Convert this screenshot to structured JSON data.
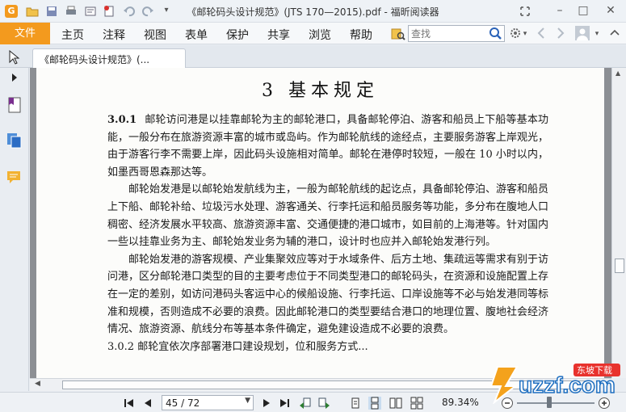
{
  "window": {
    "title": "《邮轮码头设计规范》(JTS 170—2015).pdf - 福昕阅读器",
    "app_logo_letter": "G"
  },
  "menu": {
    "file": "文件",
    "items": [
      "主页",
      "注释",
      "视图",
      "表单",
      "保护",
      "共享",
      "浏览",
      "帮助"
    ],
    "search_placeholder": "查找"
  },
  "tab": {
    "label": "《邮轮码头设计规范》(..."
  },
  "document": {
    "chapter": "3 基本规定",
    "section_number": "3.0.1",
    "para1": "邮轮访问港是以挂靠邮轮为主的邮轮港口，具备邮轮停泊、游客和船员上下船等基本功能，一般分布在旅游资源丰富的城市或岛屿。作为邮轮航线的途经点，主要服务游客上岸观光，由于游客行李不需要上岸，因此码头设施相对简单。邮轮在港停时较短，一般在 10 小时以内，如墨西哥恩森那达等。",
    "para2": "邮轮始发港是以邮轮始发航线为主，一般为邮轮航线的起讫点，具备邮轮停泊、游客和船员上下船、邮轮补给、垃圾污水处理、游客通关、行李托运和船员服务等功能，多分布在腹地人口稠密、经济发展水平较高、旅游资源丰富、交通便捷的港口城市，如目前的上海港等。针对国内一些以挂靠业务为主、邮轮始发业务为辅的港口，设计时也应并入邮轮始发港行列。",
    "para3": "邮轮始发港的游客规模、产业集聚效应等对于水域条件、后方土地、集疏运等需求有别于访问港，区分邮轮港口类型的目的主要考虑位于不同类型港口的邮轮码头，在资源和设施配置上存在一定的差别，如访问港码头客运中心的候船设施、行李托运、口岸设施等不必与始发港同等标准和规模，否则造成不必要的浪费。因此邮轮港口的类型要结合港口的地理位置、腹地社会经济情况、旅游资源、航线分布等基本条件确定，避免建设造成不必要的浪费。",
    "para4_partial": "3.0.2 邮轮宜依次序部署港口建设规划，位和服务方式..."
  },
  "statusbar": {
    "page_value": "45 / 72",
    "zoom": "89.34%"
  },
  "watermark": {
    "text": "uzzf.com",
    "badge": "东坡下载"
  },
  "colors": {
    "accent": "#f39a1e",
    "page_bg": "#fcfcfa",
    "doc_bg": "#8c8f94"
  }
}
